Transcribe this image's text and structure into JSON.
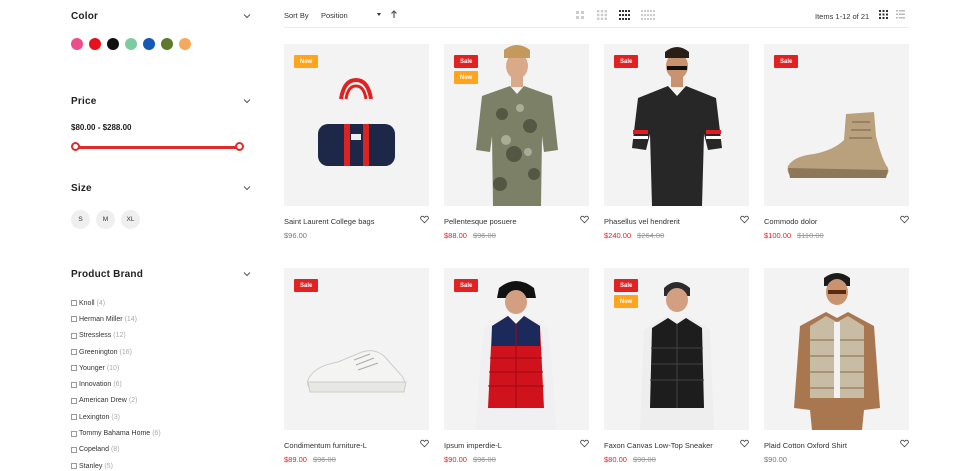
{
  "sidebar": {
    "color": {
      "title": "Color",
      "swatches": [
        {
          "name": "pink",
          "hex": "#ee4d8b"
        },
        {
          "name": "red",
          "hex": "#e8101a"
        },
        {
          "name": "black",
          "hex": "#111111"
        },
        {
          "name": "mint",
          "hex": "#7dcca0"
        },
        {
          "name": "blue",
          "hex": "#1458b8"
        },
        {
          "name": "olive",
          "hex": "#5e7a2f"
        },
        {
          "name": "orange",
          "hex": "#f5a95c"
        }
      ]
    },
    "price": {
      "title": "Price",
      "range_text": "$80.00 - $288.00",
      "min": 80,
      "max": 288
    },
    "size": {
      "title": "Size",
      "options": [
        "S",
        "M",
        "XL"
      ]
    },
    "brand": {
      "title": "Product Brand",
      "items": [
        {
          "label": "Knoll",
          "count": "(4)"
        },
        {
          "label": "Herman Miller",
          "count": "(14)"
        },
        {
          "label": "Stressless",
          "count": "(12)"
        },
        {
          "label": "Greenington",
          "count": "(16)"
        },
        {
          "label": "Younger",
          "count": "(10)"
        },
        {
          "label": "Innovation",
          "count": "(6)"
        },
        {
          "label": "American Drew",
          "count": "(2)"
        },
        {
          "label": "Lexington",
          "count": "(3)"
        },
        {
          "label": "Tommy Bahama Home",
          "count": "(6)"
        },
        {
          "label": "Copeland",
          "count": "(8)"
        },
        {
          "label": "Stanley",
          "count": "(5)"
        }
      ]
    }
  },
  "toolbar": {
    "sort_label": "Sort By",
    "sort_value": "Position",
    "items_text": "Items 1-12 of 21",
    "grid_icons": [
      "grid-2-icon",
      "grid-3-icon",
      "grid-4-icon",
      "grid-5-icon"
    ],
    "view_icons": [
      "grid-view-icon",
      "list-view-icon"
    ]
  },
  "products": [
    {
      "name": "Saint Laurent College bags",
      "price": "$96.00",
      "old_price": "",
      "badges": [
        "New"
      ],
      "art": "bag"
    },
    {
      "name": "Pellentesque posuere",
      "price": "$88.00",
      "old_price": "$96.00",
      "badges": [
        "Sale",
        "New"
      ],
      "art": "camo-shirt"
    },
    {
      "name": "Phasellus vel hendrerit",
      "price": "$240.00",
      "old_price": "$264.00",
      "badges": [
        "Sale"
      ],
      "art": "polo"
    },
    {
      "name": "Commodo dolor",
      "price": "$100.00",
      "old_price": "$110.00",
      "badges": [
        "Sale"
      ],
      "art": "sneaker-high"
    },
    {
      "name": "Condimentum furniture-L",
      "price": "$89.00",
      "old_price": "$96.00",
      "badges": [
        "Sale"
      ],
      "art": "sneaker-white"
    },
    {
      "name": "Ipsum imperdie-L",
      "price": "$90.00",
      "old_price": "$96.00",
      "badges": [
        "Sale"
      ],
      "art": "red-vest"
    },
    {
      "name": "Faxon Canvas Low-Top Sneaker",
      "price": "$80.00",
      "old_price": "$90.00",
      "badges": [
        "Sale",
        "New"
      ],
      "art": "black-vest"
    },
    {
      "name": "Plaid Cotton Oxford Shirt",
      "price": "$90.00",
      "old_price": "",
      "badges": [],
      "art": "brown-jacket"
    }
  ]
}
